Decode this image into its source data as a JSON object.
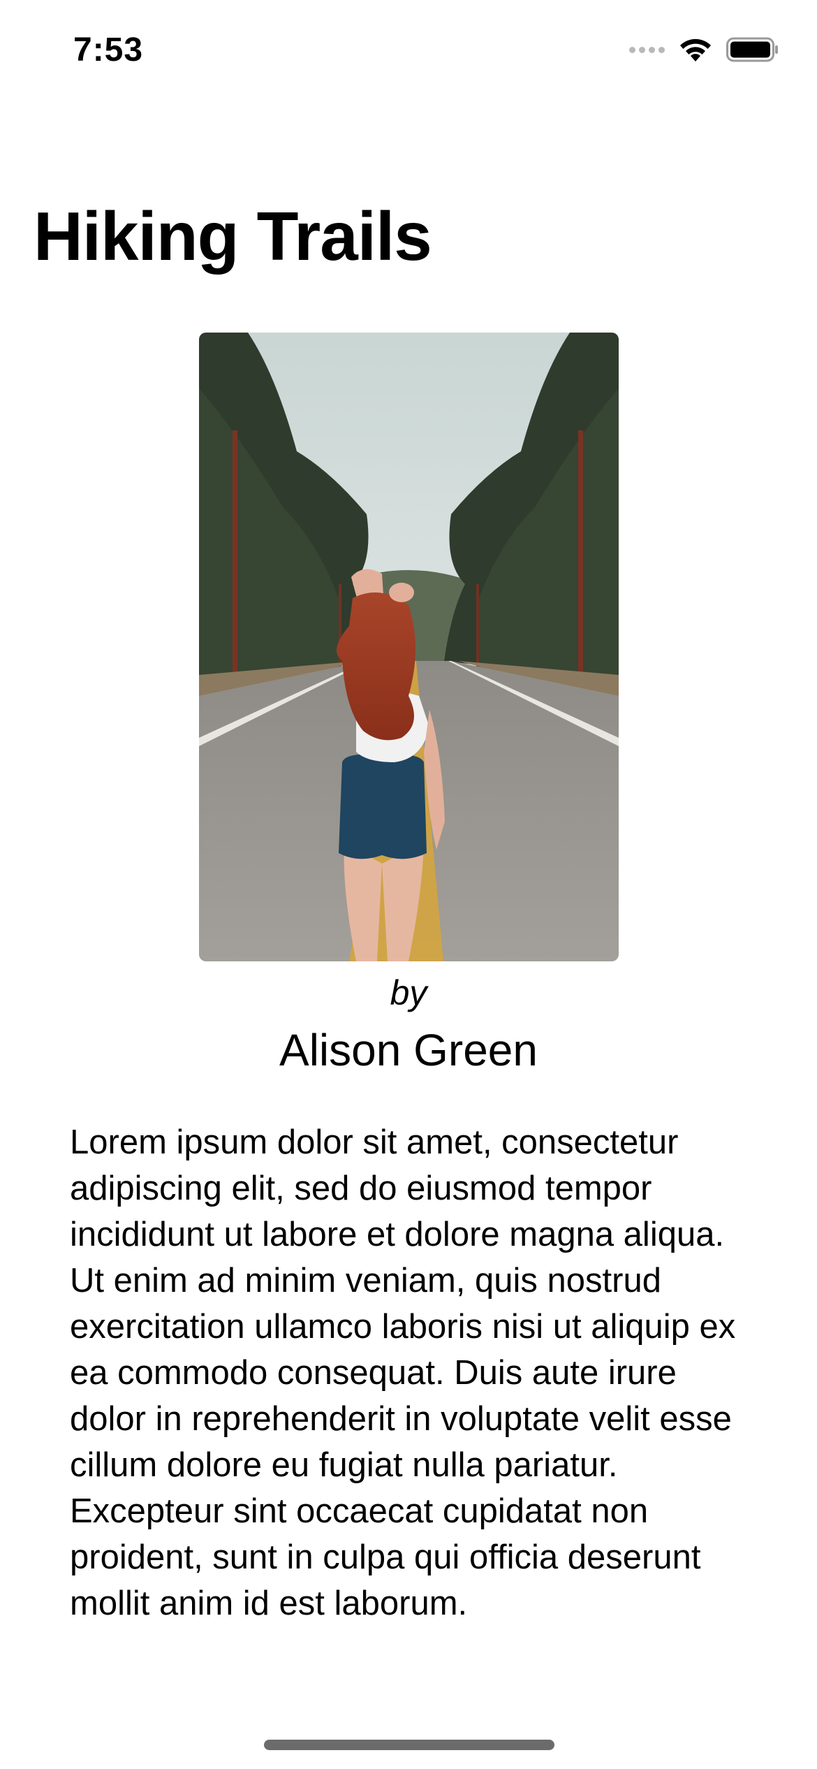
{
  "status_bar": {
    "time": "7:53"
  },
  "page": {
    "title": "Hiking Trails"
  },
  "photo": {
    "description_icon": "photo-of-woman-on-road"
  },
  "byline": {
    "prefix": "by",
    "author": "Alison Green"
  },
  "article": {
    "body": "Lorem ipsum dolor sit amet, consectetur adipiscing elit, sed do eiusmod tempor incididunt ut labore et dolore magna aliqua. Ut enim ad minim veniam, quis nostrud exercitation ullamco laboris nisi ut aliquip ex ea commodo consequat. Duis aute irure dolor in reprehenderit in voluptate velit esse cillum dolore eu fugiat nulla pariatur. Excepteur sint occaecat cupidatat non proident, sunt in culpa qui officia deserunt mollit anim id est laborum."
  },
  "colors": {
    "background": "#ffffff",
    "text": "#000000",
    "home_indicator": "#6b6b6b"
  }
}
